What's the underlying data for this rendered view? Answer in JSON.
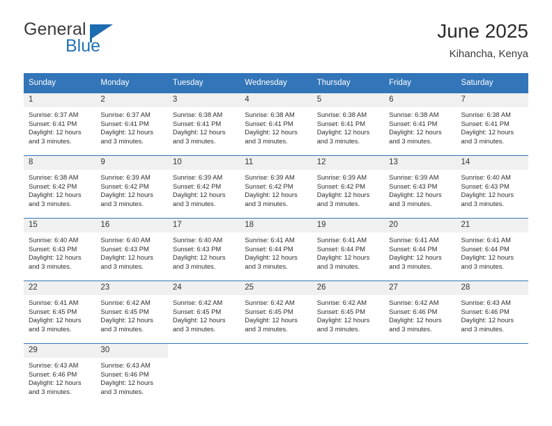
{
  "brand": {
    "name_part1": "General",
    "name_part2": "Blue",
    "logo_icon": "blue-flag-triangle",
    "accent_color": "#1c6cb1"
  },
  "header": {
    "title": "June 2025",
    "subtitle": "Kihancha, Kenya"
  },
  "theme": {
    "header_row_bg": "#3275b8",
    "daynum_bg": "#f0f0f0",
    "row_border": "#3275b8",
    "text": "#2e2e2e"
  },
  "calendar": {
    "weekday_headers": [
      "Sunday",
      "Monday",
      "Tuesday",
      "Wednesday",
      "Thursday",
      "Friday",
      "Saturday"
    ],
    "weeks": [
      [
        {
          "day": "1",
          "sunrise": "Sunrise: 6:37 AM",
          "sunset": "Sunset: 6:41 PM",
          "daylight": "Daylight: 12 hours and 3 minutes."
        },
        {
          "day": "2",
          "sunrise": "Sunrise: 6:37 AM",
          "sunset": "Sunset: 6:41 PM",
          "daylight": "Daylight: 12 hours and 3 minutes."
        },
        {
          "day": "3",
          "sunrise": "Sunrise: 6:38 AM",
          "sunset": "Sunset: 6:41 PM",
          "daylight": "Daylight: 12 hours and 3 minutes."
        },
        {
          "day": "4",
          "sunrise": "Sunrise: 6:38 AM",
          "sunset": "Sunset: 6:41 PM",
          "daylight": "Daylight: 12 hours and 3 minutes."
        },
        {
          "day": "5",
          "sunrise": "Sunrise: 6:38 AM",
          "sunset": "Sunset: 6:41 PM",
          "daylight": "Daylight: 12 hours and 3 minutes."
        },
        {
          "day": "6",
          "sunrise": "Sunrise: 6:38 AM",
          "sunset": "Sunset: 6:41 PM",
          "daylight": "Daylight: 12 hours and 3 minutes."
        },
        {
          "day": "7",
          "sunrise": "Sunrise: 6:38 AM",
          "sunset": "Sunset: 6:41 PM",
          "daylight": "Daylight: 12 hours and 3 minutes."
        }
      ],
      [
        {
          "day": "8",
          "sunrise": "Sunrise: 6:38 AM",
          "sunset": "Sunset: 6:42 PM",
          "daylight": "Daylight: 12 hours and 3 minutes."
        },
        {
          "day": "9",
          "sunrise": "Sunrise: 6:39 AM",
          "sunset": "Sunset: 6:42 PM",
          "daylight": "Daylight: 12 hours and 3 minutes."
        },
        {
          "day": "10",
          "sunrise": "Sunrise: 6:39 AM",
          "sunset": "Sunset: 6:42 PM",
          "daylight": "Daylight: 12 hours and 3 minutes."
        },
        {
          "day": "11",
          "sunrise": "Sunrise: 6:39 AM",
          "sunset": "Sunset: 6:42 PM",
          "daylight": "Daylight: 12 hours and 3 minutes."
        },
        {
          "day": "12",
          "sunrise": "Sunrise: 6:39 AM",
          "sunset": "Sunset: 6:42 PM",
          "daylight": "Daylight: 12 hours and 3 minutes."
        },
        {
          "day": "13",
          "sunrise": "Sunrise: 6:39 AM",
          "sunset": "Sunset: 6:43 PM",
          "daylight": "Daylight: 12 hours and 3 minutes."
        },
        {
          "day": "14",
          "sunrise": "Sunrise: 6:40 AM",
          "sunset": "Sunset: 6:43 PM",
          "daylight": "Daylight: 12 hours and 3 minutes."
        }
      ],
      [
        {
          "day": "15",
          "sunrise": "Sunrise: 6:40 AM",
          "sunset": "Sunset: 6:43 PM",
          "daylight": "Daylight: 12 hours and 3 minutes."
        },
        {
          "day": "16",
          "sunrise": "Sunrise: 6:40 AM",
          "sunset": "Sunset: 6:43 PM",
          "daylight": "Daylight: 12 hours and 3 minutes."
        },
        {
          "day": "17",
          "sunrise": "Sunrise: 6:40 AM",
          "sunset": "Sunset: 6:43 PM",
          "daylight": "Daylight: 12 hours and 3 minutes."
        },
        {
          "day": "18",
          "sunrise": "Sunrise: 6:41 AM",
          "sunset": "Sunset: 6:44 PM",
          "daylight": "Daylight: 12 hours and 3 minutes."
        },
        {
          "day": "19",
          "sunrise": "Sunrise: 6:41 AM",
          "sunset": "Sunset: 6:44 PM",
          "daylight": "Daylight: 12 hours and 3 minutes."
        },
        {
          "day": "20",
          "sunrise": "Sunrise: 6:41 AM",
          "sunset": "Sunset: 6:44 PM",
          "daylight": "Daylight: 12 hours and 3 minutes."
        },
        {
          "day": "21",
          "sunrise": "Sunrise: 6:41 AM",
          "sunset": "Sunset: 6:44 PM",
          "daylight": "Daylight: 12 hours and 3 minutes."
        }
      ],
      [
        {
          "day": "22",
          "sunrise": "Sunrise: 6:41 AM",
          "sunset": "Sunset: 6:45 PM",
          "daylight": "Daylight: 12 hours and 3 minutes."
        },
        {
          "day": "23",
          "sunrise": "Sunrise: 6:42 AM",
          "sunset": "Sunset: 6:45 PM",
          "daylight": "Daylight: 12 hours and 3 minutes."
        },
        {
          "day": "24",
          "sunrise": "Sunrise: 6:42 AM",
          "sunset": "Sunset: 6:45 PM",
          "daylight": "Daylight: 12 hours and 3 minutes."
        },
        {
          "day": "25",
          "sunrise": "Sunrise: 6:42 AM",
          "sunset": "Sunset: 6:45 PM",
          "daylight": "Daylight: 12 hours and 3 minutes."
        },
        {
          "day": "26",
          "sunrise": "Sunrise: 6:42 AM",
          "sunset": "Sunset: 6:45 PM",
          "daylight": "Daylight: 12 hours and 3 minutes."
        },
        {
          "day": "27",
          "sunrise": "Sunrise: 6:42 AM",
          "sunset": "Sunset: 6:46 PM",
          "daylight": "Daylight: 12 hours and 3 minutes."
        },
        {
          "day": "28",
          "sunrise": "Sunrise: 6:43 AM",
          "sunset": "Sunset: 6:46 PM",
          "daylight": "Daylight: 12 hours and 3 minutes."
        }
      ],
      [
        {
          "day": "29",
          "sunrise": "Sunrise: 6:43 AM",
          "sunset": "Sunset: 6:46 PM",
          "daylight": "Daylight: 12 hours and 3 minutes."
        },
        {
          "day": "30",
          "sunrise": "Sunrise: 6:43 AM",
          "sunset": "Sunset: 6:46 PM",
          "daylight": "Daylight: 12 hours and 3 minutes."
        },
        {
          "day": "",
          "sunrise": "",
          "sunset": "",
          "daylight": ""
        },
        {
          "day": "",
          "sunrise": "",
          "sunset": "",
          "daylight": ""
        },
        {
          "day": "",
          "sunrise": "",
          "sunset": "",
          "daylight": ""
        },
        {
          "day": "",
          "sunrise": "",
          "sunset": "",
          "daylight": ""
        },
        {
          "day": "",
          "sunrise": "",
          "sunset": "",
          "daylight": ""
        }
      ]
    ]
  }
}
